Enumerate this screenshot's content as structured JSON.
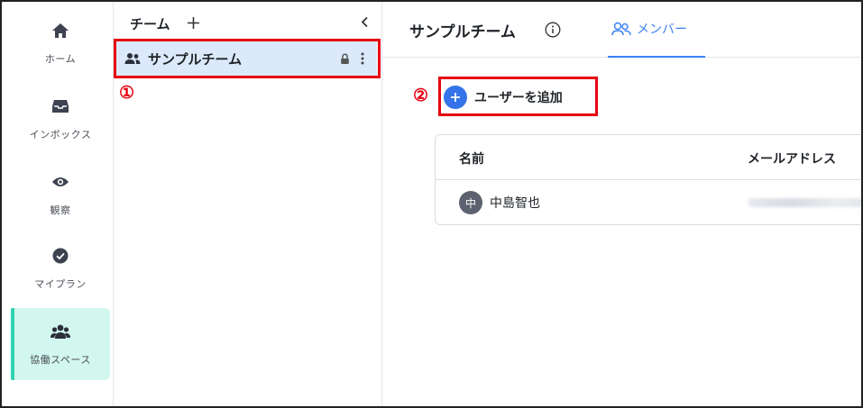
{
  "nav": {
    "items": [
      {
        "label": "ホーム",
        "icon": "home-icon"
      },
      {
        "label": "インボックス",
        "icon": "inbox-icon"
      },
      {
        "label": "観察",
        "icon": "eye-icon"
      },
      {
        "label": "マイプラン",
        "icon": "check-circle-icon"
      },
      {
        "label": "協働スペース",
        "icon": "team-icon",
        "active": true
      }
    ]
  },
  "team_panel": {
    "title": "チーム",
    "add_icon": "plus-icon",
    "collapse_icon": "chevron-left-icon",
    "teams": [
      {
        "name": "サンプルチーム",
        "icon": "people-icon",
        "locked": true
      }
    ]
  },
  "main": {
    "title": "サンプルチーム",
    "info_icon": "info-icon",
    "tab": {
      "label": "メンバー",
      "icon": "members-icon"
    },
    "add_user_label": "ユーザーを追加",
    "table": {
      "headers": [
        "名前",
        "メールアドレス"
      ],
      "rows": [
        {
          "avatar_text": "中",
          "name": "中島智也"
        }
      ]
    }
  },
  "annotations": {
    "marker1": "①",
    "marker2": "②"
  },
  "colors": {
    "accent": "#3474e8",
    "active_nav_bg": "#d2f7ee",
    "active_nav_bar": "#2fd3b1",
    "selected_team_bg": "#dbe9fb",
    "highlight": "#e60012"
  }
}
